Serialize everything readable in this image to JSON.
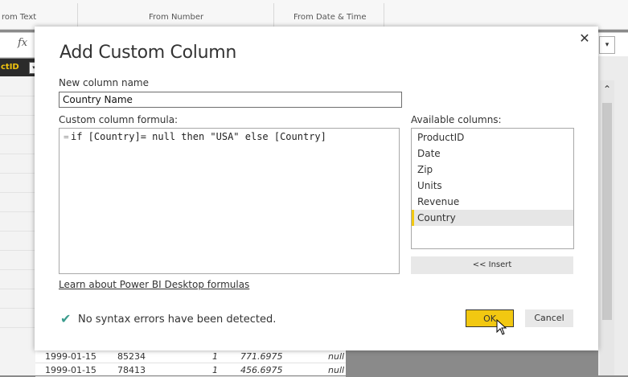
{
  "ribbon": {
    "groups": [
      "rom Text",
      "From Number",
      "From Date & Time"
    ]
  },
  "formula_bar": {
    "fx": "fx",
    "dropdown": "▾"
  },
  "grid": {
    "column_header": "ctID",
    "header_button": "▾",
    "rows": [
      {
        "date": "1999-01-15",
        "zip": "85234",
        "units": "1",
        "revenue": "771.6975",
        "country": "null"
      },
      {
        "date": "1999-01-15",
        "zip": "78413",
        "units": "1",
        "revenue": "456.6975",
        "country": "null"
      }
    ]
  },
  "dialog": {
    "title": "Add Custom Column",
    "close": "✕",
    "new_column_label": "New column name",
    "new_column_value": "Country Name",
    "formula_label": "Custom column formula:",
    "formula_prefix": "=",
    "formula": "if [Country]= null then \"USA\" else [Country]",
    "available_label": "Available columns:",
    "available_columns": [
      "ProductID",
      "Date",
      "Zip",
      "Units",
      "Revenue",
      "Country"
    ],
    "selected_column": "Country",
    "insert_label": "<< Insert",
    "learn_link": "Learn about Power BI Desktop formulas",
    "status_icon": "check-icon",
    "status_text": "No syntax errors have been detected.",
    "ok_label": "OK",
    "cancel_label": "Cancel"
  },
  "colors": {
    "accent": "#f2c811",
    "check": "#3b9c8d"
  }
}
